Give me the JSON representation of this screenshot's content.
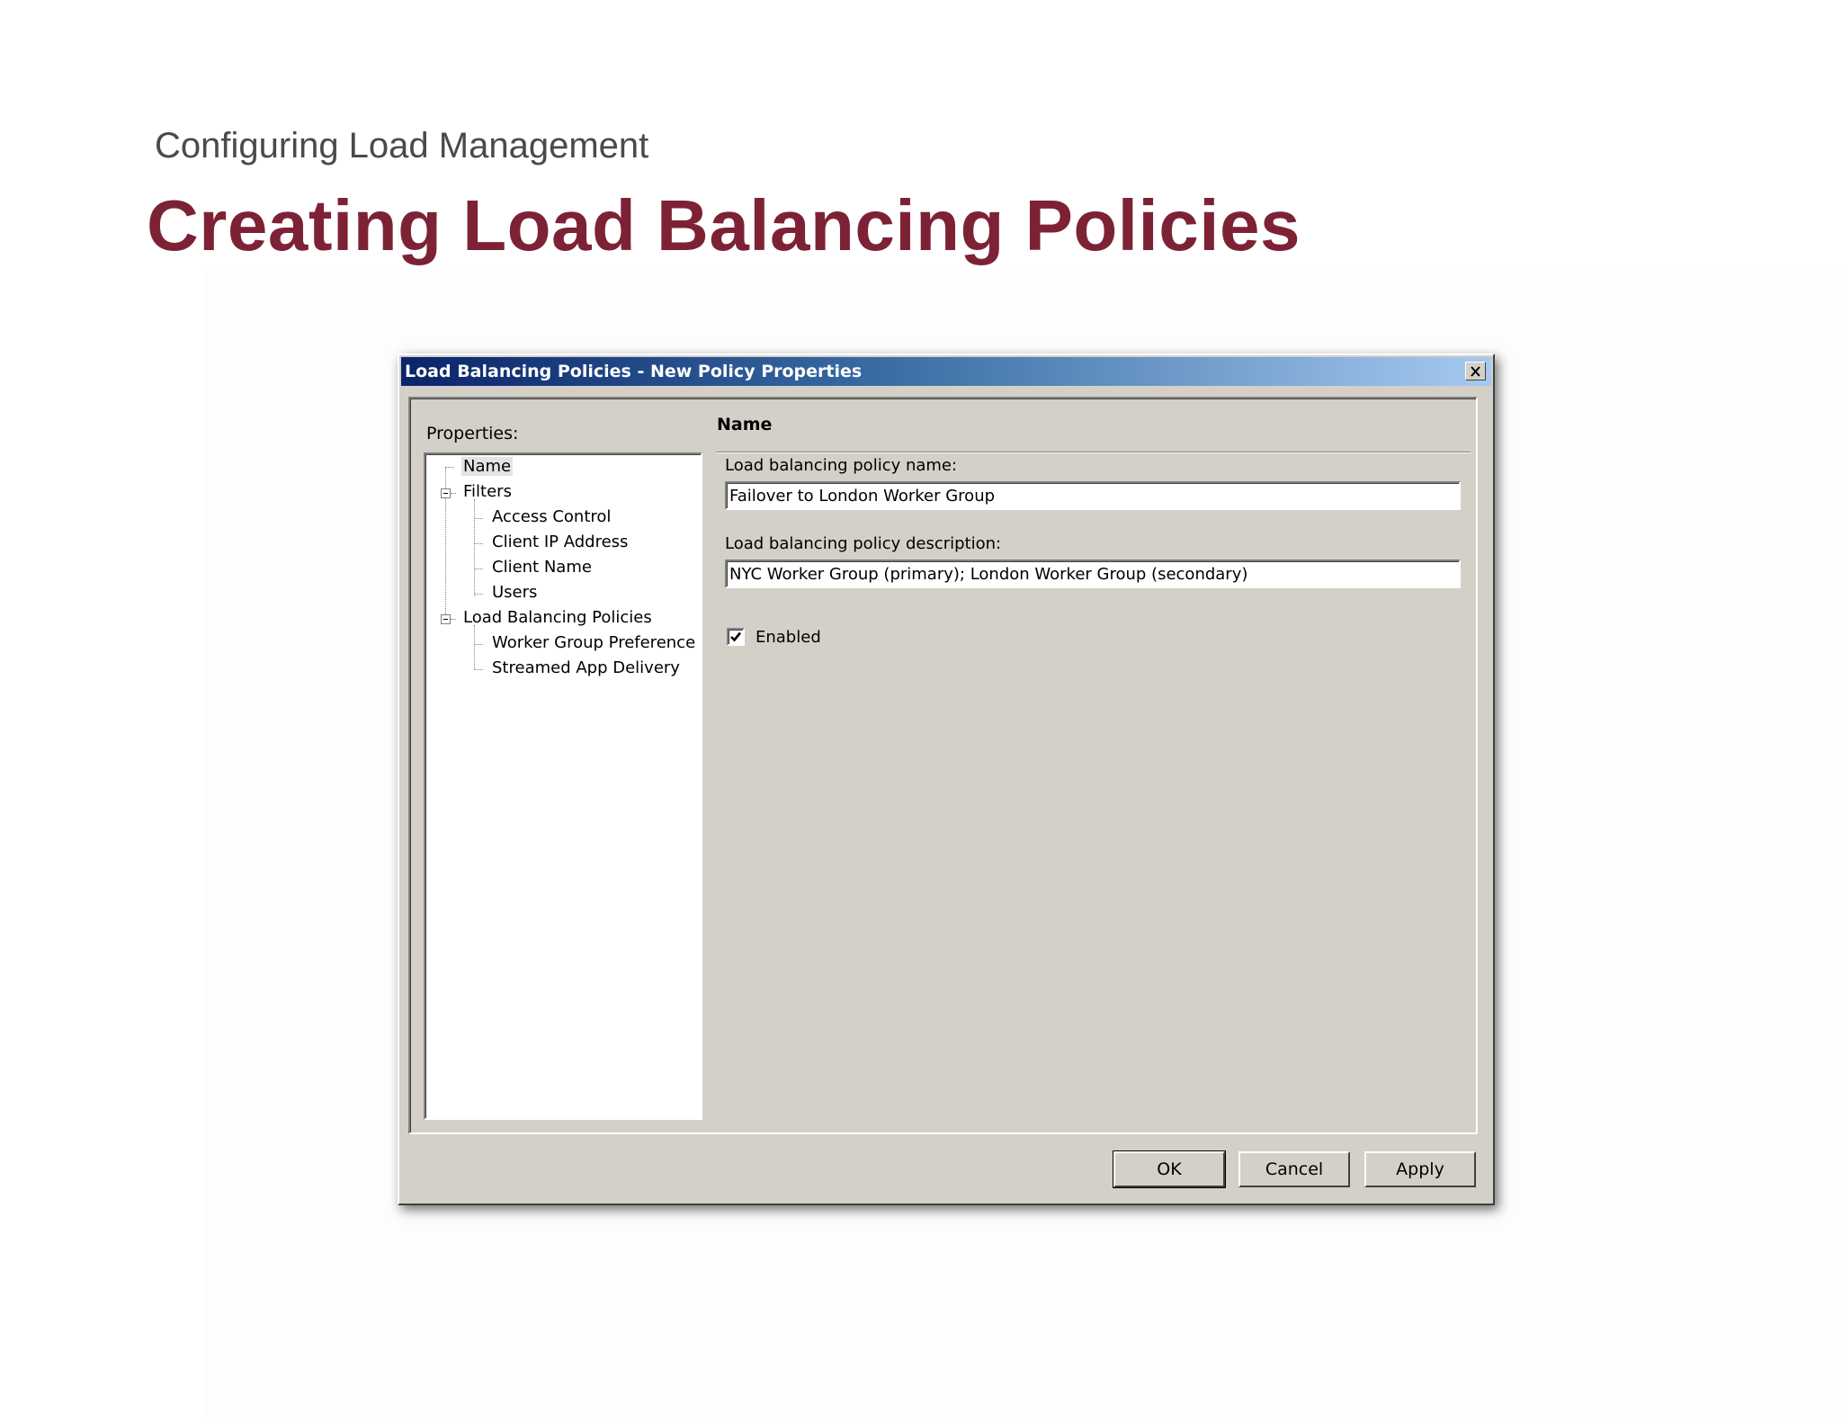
{
  "slide": {
    "subtitle": "Configuring Load Management",
    "title": "Creating Load Balancing Policies"
  },
  "dialog": {
    "title": "Load Balancing Policies - New Policy Properties",
    "properties_label": "Properties:",
    "tree": [
      {
        "label": "Name",
        "selected": true
      },
      {
        "label": "Filters",
        "expanded": true
      },
      {
        "label": "Access Control"
      },
      {
        "label": "Client IP Address"
      },
      {
        "label": "Client Name"
      },
      {
        "label": "Users"
      },
      {
        "label": "Load Balancing Policies",
        "expanded": true
      },
      {
        "label": "Worker Group Preference"
      },
      {
        "label": "Streamed App Delivery"
      }
    ],
    "section_title": "Name",
    "name_label": "Load balancing policy name:",
    "name_value": "Failover to London Worker Group",
    "description_label": "Load balancing policy description:",
    "description_value": "NYC Worker Group (primary); London Worker Group (secondary)",
    "enabled_label": "Enabled",
    "enabled": true,
    "buttons": {
      "ok": "OK",
      "cancel": "Cancel",
      "apply": "Apply"
    }
  },
  "icons": {
    "close": "close-icon",
    "checkbox": "checkmark-icon",
    "expander": "minus-expander-icon"
  }
}
